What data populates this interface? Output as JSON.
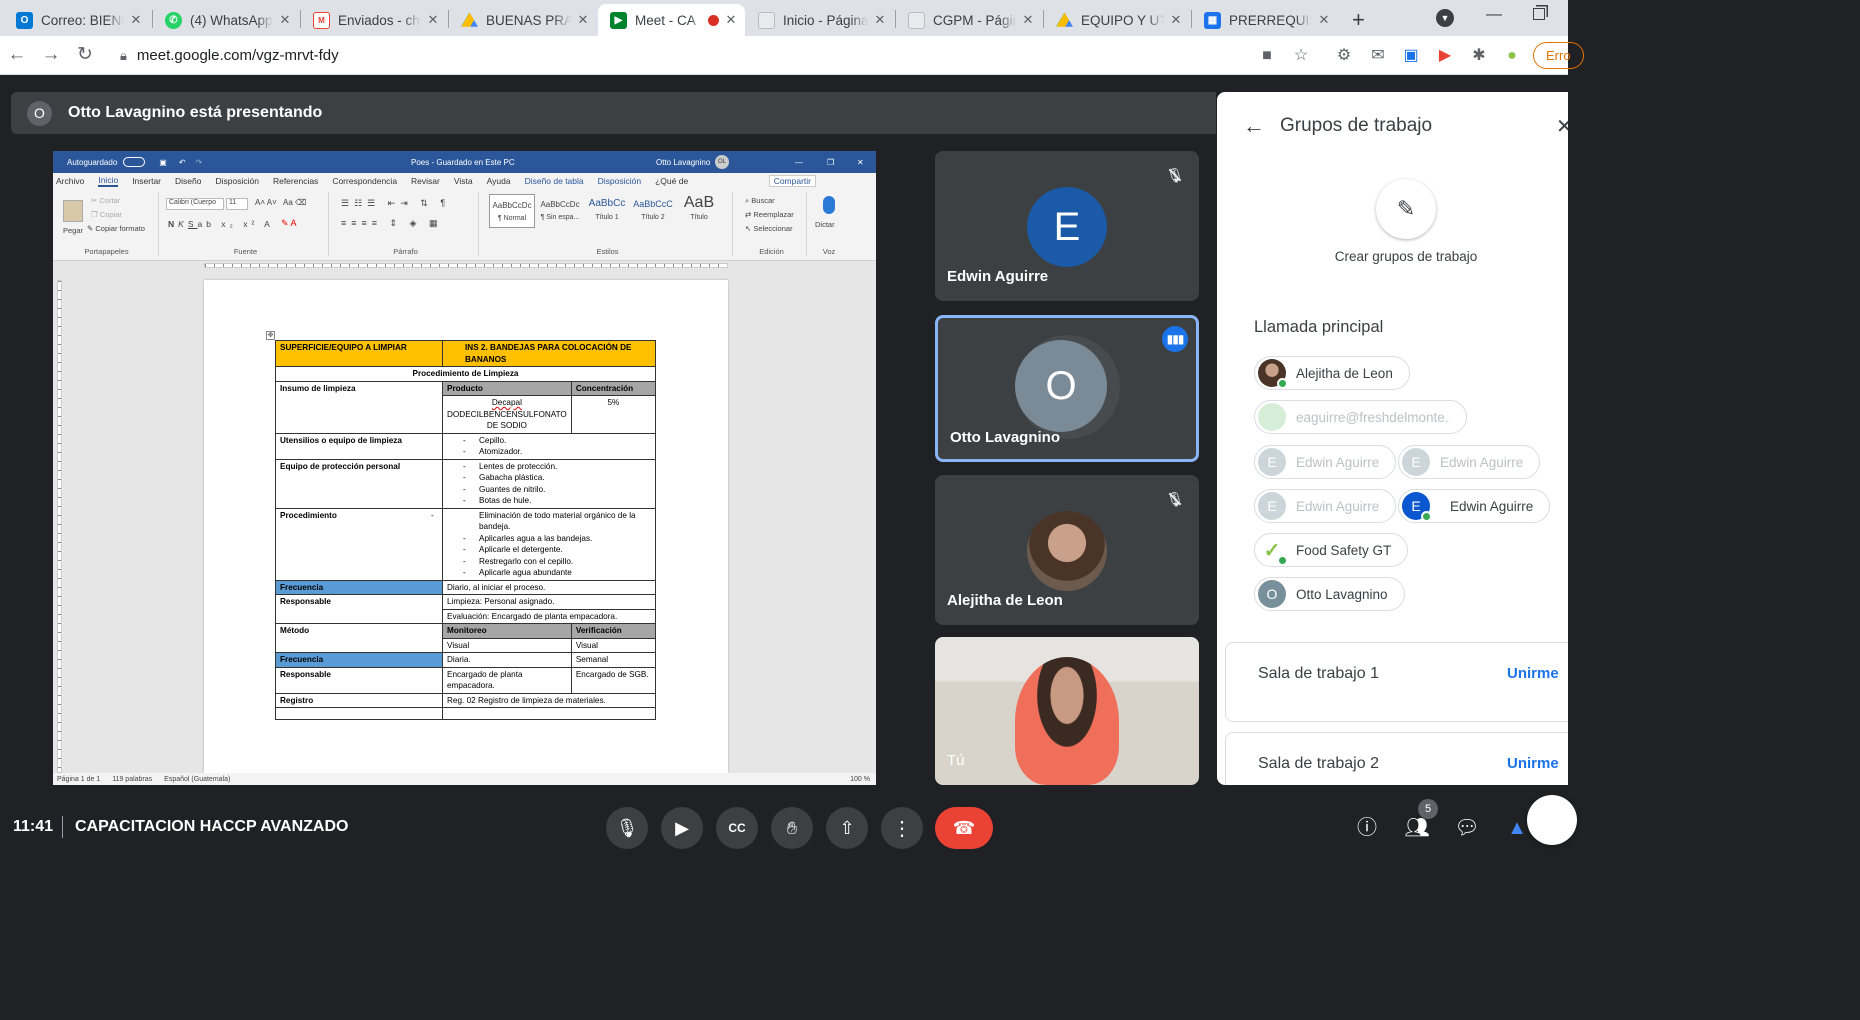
{
  "browser": {
    "tabs": [
      {
        "title": "Correo: BIENES",
        "icon": "outlook-icon",
        "color": "#0078d4"
      },
      {
        "title": "(4) WhatsApp",
        "icon": "whatsapp-icon",
        "color": "#25d366"
      },
      {
        "title": "Enviados - che",
        "icon": "gmail-icon",
        "color": "#ea4335"
      },
      {
        "title": "BUENAS PRAC",
        "icon": "drive-icon",
        "color": "#fbbc04"
      },
      {
        "title": "Meet - CA",
        "icon": "meet-icon",
        "color": "#00832d"
      },
      {
        "title": "Inicio - Página",
        "icon": "site-icon",
        "color": "#9aa0a6"
      },
      {
        "title": "CGPM - Págin",
        "icon": "site-icon",
        "color": "#9aa0a6"
      },
      {
        "title": "EQUIPO Y UTE",
        "icon": "drive-icon",
        "color": "#fbbc04"
      },
      {
        "title": "PRERREQUISIT",
        "icon": "sites-icon",
        "color": "#1a73e8"
      }
    ],
    "url": "meet.google.com/vgz-mrvt-fdy",
    "profile_label": "Erro"
  },
  "meeting": {
    "presenting_banner": "Otto Lavagnino está presentando",
    "presenter_initial": "O",
    "time": "11:41",
    "title": "CAPACITACION HACCP AVANZADO",
    "participants_count": "5"
  },
  "word": {
    "autosave": "Autoguardado",
    "doc_title": "Poes - Guardado en Este PC",
    "user": "Otto Lavagnino",
    "user_initials": "OL",
    "menu": [
      "Archivo",
      "Inicio",
      "Insertar",
      "Diseño",
      "Disposición",
      "Referencias",
      "Correspondencia",
      "Revisar",
      "Vista",
      "Ayuda",
      "Diseño de tabla",
      "Disposición",
      "¿Qué de"
    ],
    "share": "Compartir",
    "ribbon": {
      "paste": "Pegar",
      "cut": "Cortar",
      "copy": "Copiar",
      "format_painter": "Copiar formato",
      "clipboard": "Portapapeles",
      "font_name": "Calibri (Cuerpo",
      "font_size": "11",
      "font": "Fuente",
      "paragraph": "Párrafo",
      "styles_label": "Estilos",
      "styles": [
        {
          "sample": "AaBbCcDc",
          "name": "¶ Normal"
        },
        {
          "sample": "AaBbCcDc",
          "name": "¶ Sin espa..."
        },
        {
          "sample": "AaBbCc",
          "name": "Título 1"
        },
        {
          "sample": "AaBbCcC",
          "name": "Título 2"
        },
        {
          "sample": "AaB",
          "name": "Título"
        }
      ],
      "find": "Buscar",
      "replace": "Reemplazar",
      "select": "Seleccionar",
      "editing": "Edición",
      "dictate": "Dictar",
      "voice": "Voz"
    },
    "status": {
      "page": "Página 1 de 1",
      "words": "119 palabras",
      "language": "Español (Guatemala)",
      "zoom": "100 %"
    },
    "table": {
      "r0a": "SUPERFICIE/EQUIPO A LIMPIAR",
      "r0b": "INS 2. BANDEJAS PARA COLOCACIÓN DE BANANOS",
      "r1": "Procedimiento de Limpieza",
      "insumo": "Insumo de limpieza",
      "producto_h": "Producto",
      "conc_h": "Concentración",
      "producto1": "Decapal",
      "producto2": "DODECILBENCENSULFONATO DE SODIO",
      "conc": "5%",
      "utensilios": "Utensilios o equipo de limpieza",
      "utensilios_items": [
        "Cepillo.",
        "Atomizador."
      ],
      "epp": "Equipo de protección personal",
      "epp_items": [
        "Lentes de protección.",
        "Gabacha plástica.",
        "Guantes de nitrilo.",
        "Botas de hule."
      ],
      "proc": "Procedimiento",
      "proc_items": [
        "Eliminación de todo material orgánico de la bandeja.",
        "Aplicarles agua a las bandejas.",
        "Aplicarle el detergente.",
        "Restregarlo con el cepillo.",
        "Aplicarle agua abundante"
      ],
      "frecuencia": "Frecuencia",
      "frec_val": "Diario, al iniciar el proceso.",
      "responsable": "Responsable",
      "resp1": "Limpieza: Personal asignado.",
      "resp2": "Evaluación: Encargado de planta empacadora.",
      "metodo": "Método",
      "monitoreo_h": "Monitoreo",
      "verif_h": "Verificación",
      "visual1": "Visual",
      "visual2": "Visual",
      "frec2": "Frecuencia",
      "diaria": "Diaria.",
      "semanal": "Semanal",
      "resp3": "Responsable",
      "resp3a": "Encargado de planta empacadora.",
      "resp3b": "Encargado de SGB.",
      "registro": "Registro",
      "registro_val": "Reg. 02 Registro de limpieza de materiales."
    }
  },
  "tiles": [
    {
      "name": "Edwin Aguirre",
      "initial": "E",
      "color": "#1a5aa8",
      "muted": true
    },
    {
      "name": "Otto Lavagnino",
      "initial": "O",
      "color": "#7a8a96",
      "speaking": true
    },
    {
      "name": "Alejitha de Leon",
      "muted": true
    },
    {
      "name": "Tú"
    }
  ],
  "panel": {
    "title": "Grupos de trabajo",
    "create": "Crear grupos de trabajo",
    "main_call": "Llamada principal",
    "chips": [
      {
        "label": "Alejitha de Leon",
        "initial": "",
        "color": "#8d6e63",
        "online": true
      },
      {
        "label": "eaguirre@freshdelmonte....",
        "initial": "",
        "color": "#a5d6a7",
        "dim": true
      },
      {
        "label": "Edwin Aguirre",
        "initial": "E",
        "color": "#90a4ae",
        "dim": true
      },
      {
        "label": "Edwin Aguirre",
        "initial": "E",
        "color": "#90a4ae",
        "dim": true
      },
      {
        "label": "Edwin Aguirre",
        "initial": "E",
        "color": "#90a4ae",
        "dim": true
      },
      {
        "label": "Edwin Aguirre",
        "initial": "E",
        "color": "#0b57d0",
        "online": true
      },
      {
        "label": "Food Safety GT",
        "initial": "✓",
        "color": "#8bc34a",
        "online": true
      },
      {
        "label": "Otto Lavagnino",
        "initial": "O",
        "color": "#78909c"
      }
    ],
    "rooms": [
      {
        "name": "Sala de trabajo 1",
        "join": "Unirme"
      },
      {
        "name": "Sala de trabajo 2",
        "join": "Unirme"
      }
    ]
  }
}
